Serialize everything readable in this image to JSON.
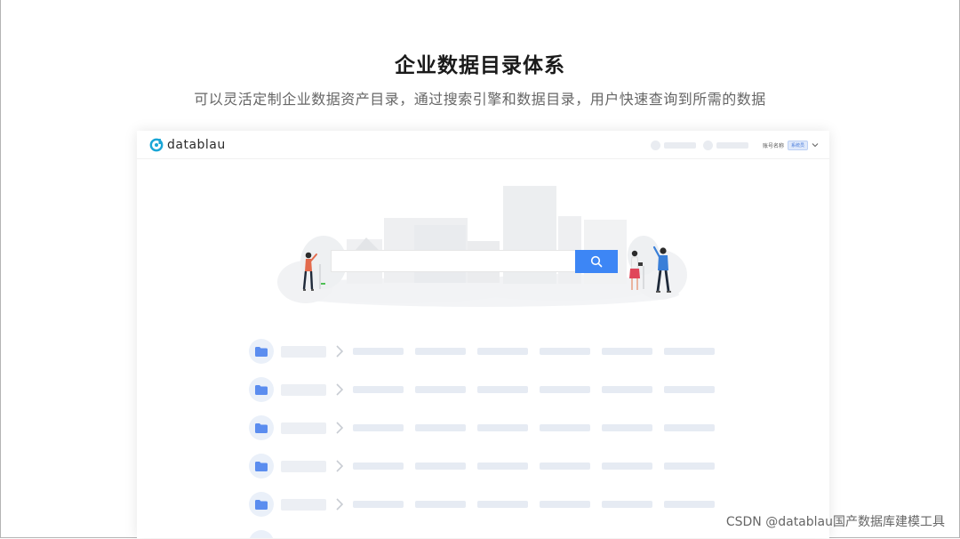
{
  "slide": {
    "title": "企业数据目录体系",
    "subtitle": "可以灵活定制企业数据资产目录，通过搜索引擎和数据目录，用户快速查询到所需的数据"
  },
  "app": {
    "logo_text": "datablau",
    "account_name": "账号名称",
    "account_badge": "系统员"
  },
  "search": {
    "placeholder": ""
  },
  "catalog_rows": [
    {
      "icon": "folder-icon"
    },
    {
      "icon": "folder-icon"
    },
    {
      "icon": "folder-icon"
    },
    {
      "icon": "folder-icon"
    },
    {
      "icon": "folder-icon"
    }
  ],
  "watermark": "CSDN @datablau国产数据库建模工具",
  "colors": {
    "accent": "#3d86f5",
    "placeholder": "#e6ebf3",
    "folder": "#5b8def"
  }
}
